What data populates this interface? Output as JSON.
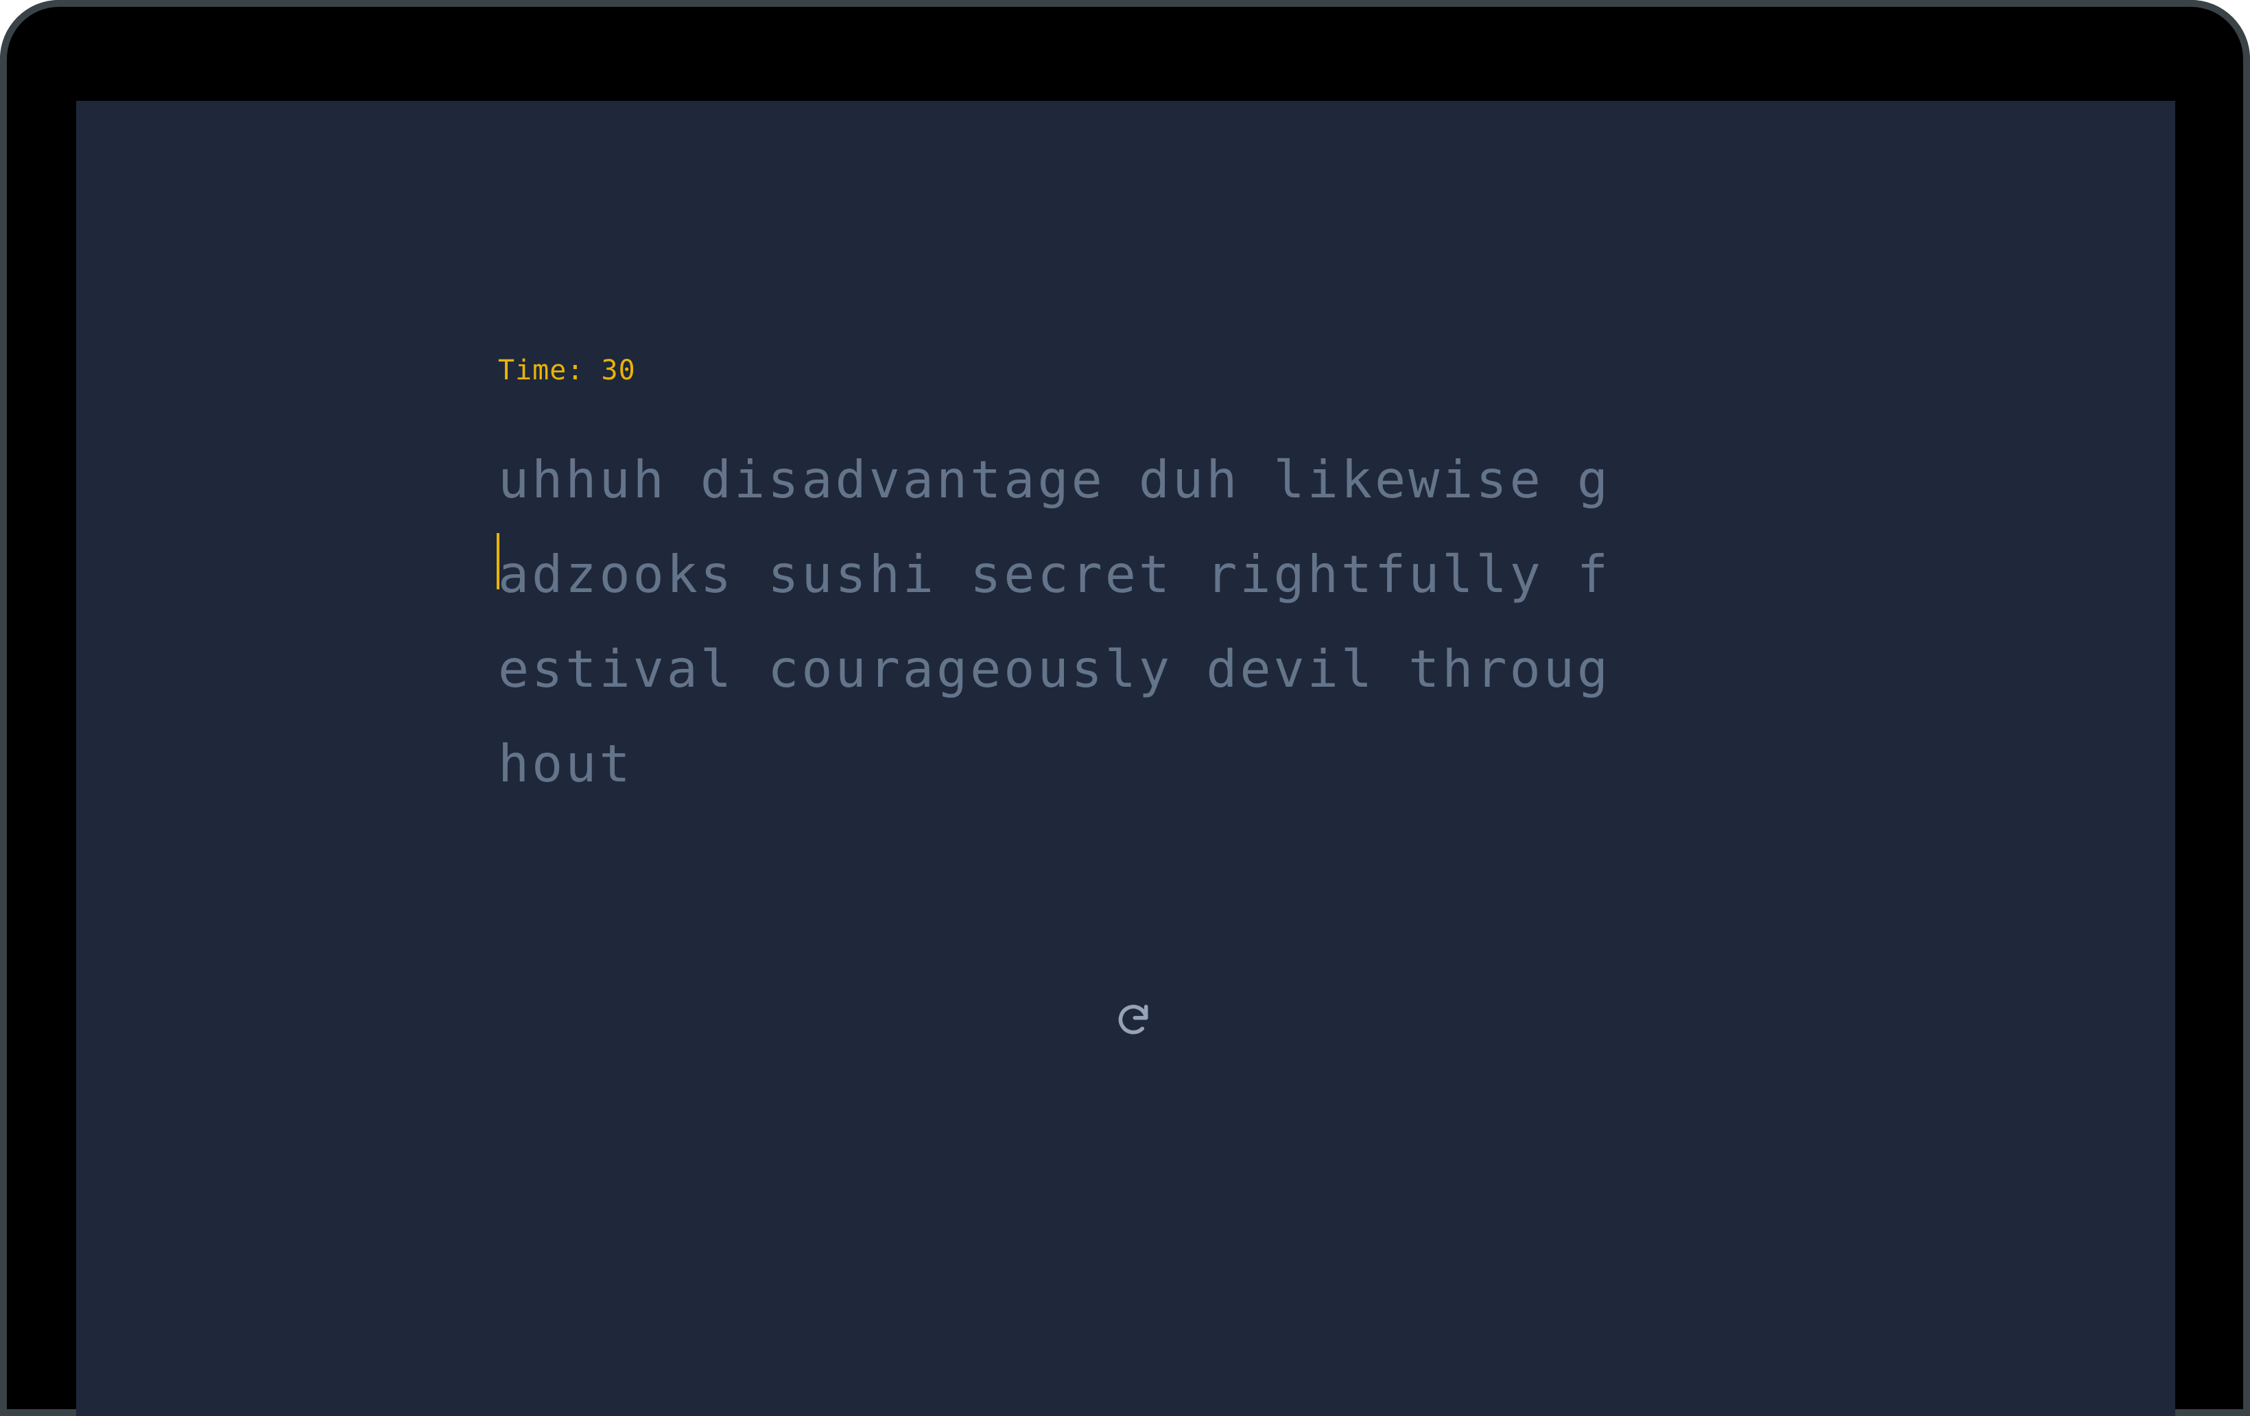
{
  "timer": {
    "label": "Time: 30"
  },
  "typing_text": {
    "lines": [
      "uhhuh disadvantage duh likewise g",
      "adzooks sushi secret rightfully f",
      "estival courageously devil throug",
      "hout"
    ]
  },
  "controls": {
    "restart_icon": "restart-icon"
  },
  "colors": {
    "background": "#1f283a",
    "accent": "#eab308",
    "text_muted": "#64748b",
    "frame": "#000000"
  }
}
